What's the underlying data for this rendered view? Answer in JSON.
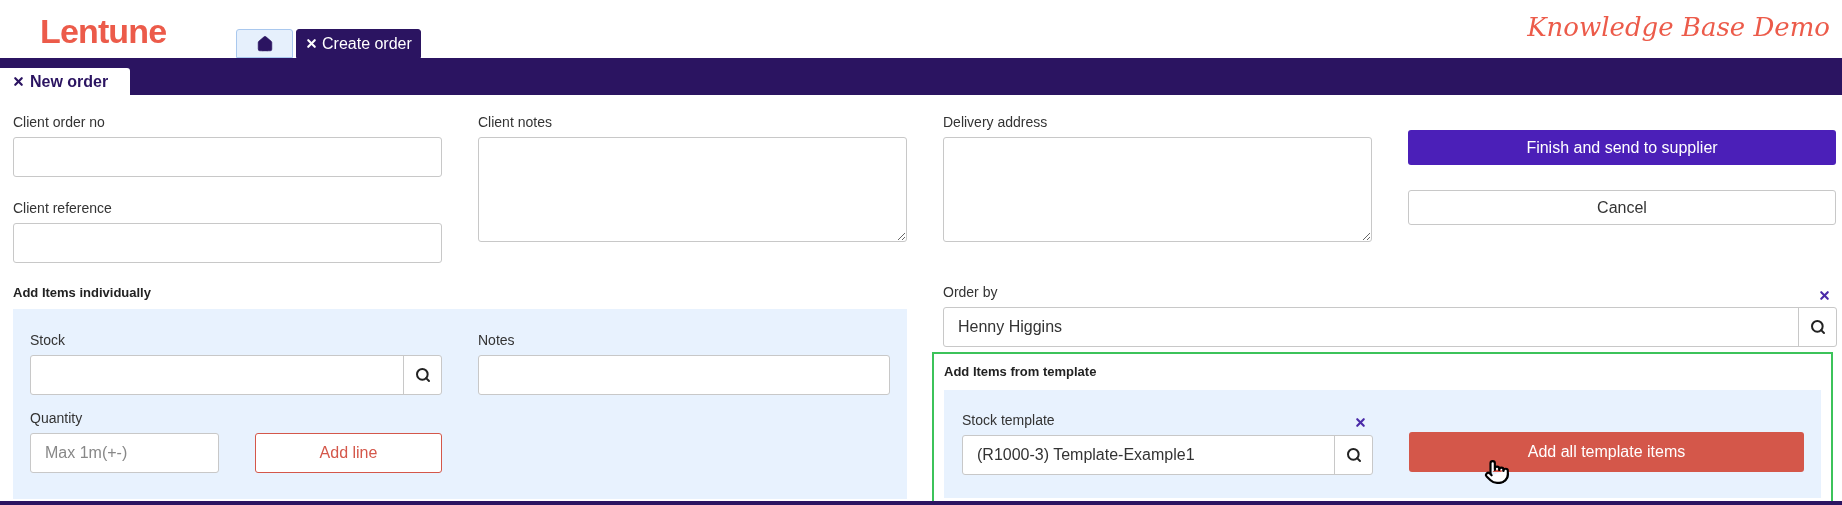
{
  "header": {
    "logo": "Lentune",
    "tagline": "Knowledge Base Demo"
  },
  "tabs": [
    {
      "kind": "home",
      "selected": false
    },
    {
      "kind": "page",
      "label": "Create order",
      "closable": true,
      "selected": true
    }
  ],
  "subtabs": [
    {
      "label": "New order",
      "closable": true,
      "selected": true
    }
  ],
  "form": {
    "client_order_no": {
      "label": "Client order no"
    },
    "client_reference": {
      "label": "Client reference"
    },
    "client_notes": {
      "label": "Client notes"
    },
    "delivery_address": {
      "label": "Delivery address"
    },
    "finish_button": "Finish and send to supplier",
    "cancel_button": "Cancel",
    "add_individually": {
      "title": "Add Items individually",
      "stock": {
        "label": "Stock"
      },
      "notes": {
        "label": "Notes"
      },
      "quantity": {
        "label": "Quantity",
        "placeholder": "Max 1m(+-)"
      },
      "add_button": "Add line"
    },
    "order_by": {
      "label": "Order by",
      "value": "Henny Higgins",
      "clearable": true
    },
    "template": {
      "title": "Add Items from template",
      "highlighted": true,
      "stock_template": {
        "label": "Stock template",
        "value": "(R1000-3) Template-Example1",
        "clearable": true
      },
      "add_button": "Add all template items"
    }
  }
}
